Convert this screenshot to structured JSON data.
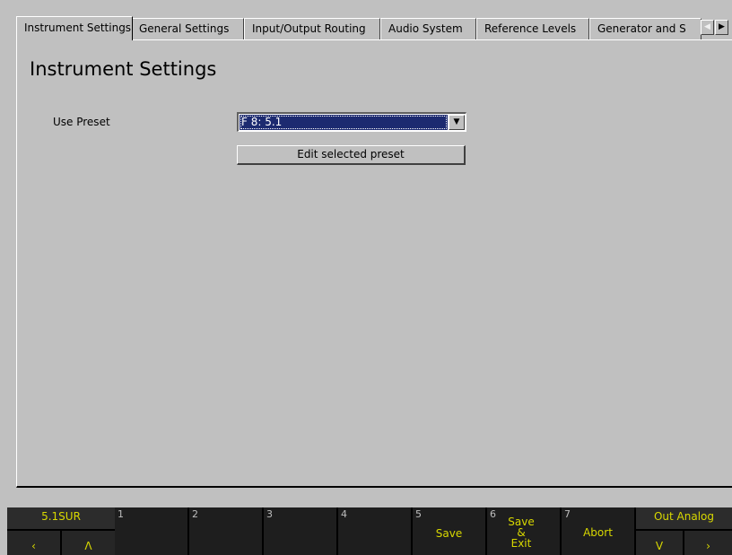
{
  "tabs": [
    {
      "label": "Instrument Settings",
      "active": true
    },
    {
      "label": "General Settings"
    },
    {
      "label": "Input/Output Routing"
    },
    {
      "label": "Audio System"
    },
    {
      "label": "Reference Levels"
    },
    {
      "label": "Generator and S"
    }
  ],
  "tab_scroll": {
    "left": "◀",
    "right": "▶"
  },
  "page": {
    "title": "Instrument Settings",
    "preset_label": "Use Preset",
    "preset_value": "F 8: 5.1",
    "dropdown_arrow": "▼",
    "edit_button": "Edit selected preset"
  },
  "softkeys": {
    "left_top": "5.1SUR",
    "left_bottom_a": "‹",
    "left_bottom_b": "Λ",
    "keys": [
      {
        "num": "1",
        "label": ""
      },
      {
        "num": "2",
        "label": ""
      },
      {
        "num": "3",
        "label": ""
      },
      {
        "num": "4",
        "label": ""
      },
      {
        "num": "5",
        "label": "Save"
      },
      {
        "num": "6",
        "label_line1": "Save",
        "label_line2": "&",
        "label_line3": "Exit"
      },
      {
        "num": "7",
        "label": "Abort"
      }
    ],
    "right_top": "Out Analog",
    "right_bottom_a": "V",
    "right_bottom_b": "›"
  },
  "colors": {
    "background": "#c0c0c0",
    "selection": "#1c2a70",
    "softkey_text": "#d8d800"
  }
}
